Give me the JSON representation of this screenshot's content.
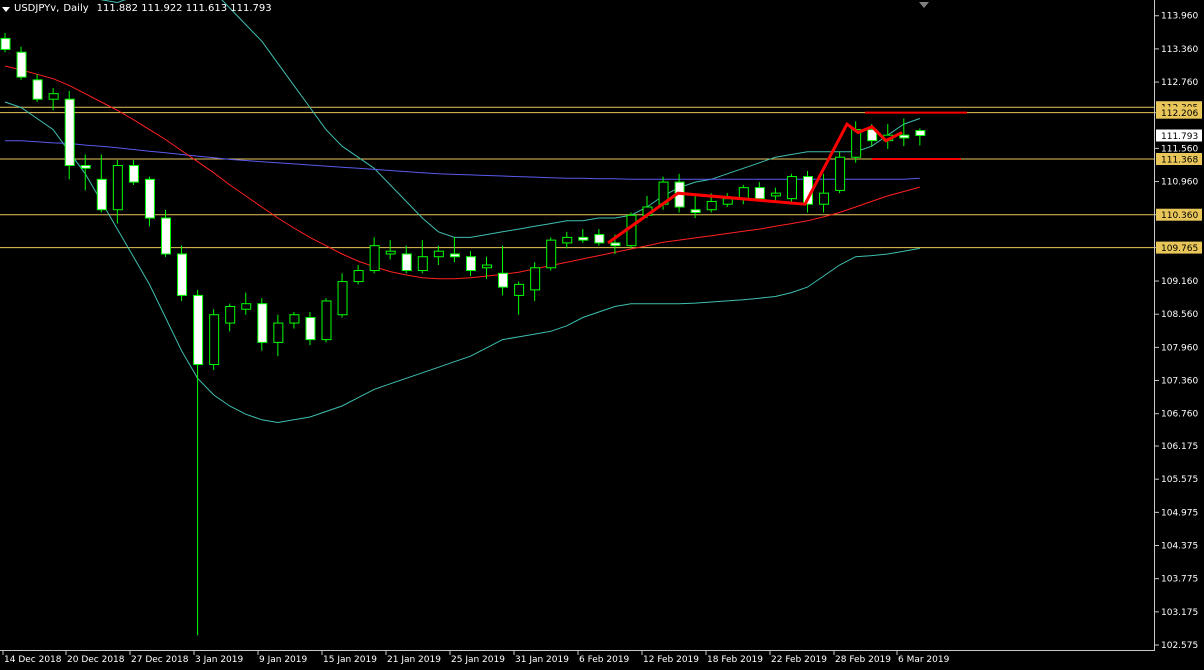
{
  "header": {
    "symbol": "USDJPYv",
    "timeframe": "Daily",
    "ohlc": "111.882 111.922 111.613 111.793"
  },
  "colors": {
    "background": "#000000",
    "bull_candle": "#000000",
    "bear_candle": "#ffffff",
    "wick": "#00ff00",
    "level_line": "#e8c65a",
    "ma_red": "#ff2020",
    "ma_blue": "#5a5af0",
    "band_cyan": "#3fbfb0",
    "drawing_red": "#ff0000"
  },
  "chart_data": {
    "type": "candlestick",
    "symbol": "USDJPYv",
    "timeframe": "Daily",
    "y_range": [
      102.575,
      114.1
    ],
    "y_ticks": [
      "113.960",
      "113.360",
      "112.760",
      "112.206",
      "111.560",
      "110.960",
      "110.360",
      "109.765",
      "109.160",
      "108.560",
      "107.960",
      "107.360",
      "106.760",
      "106.175",
      "105.575",
      "104.975",
      "104.375",
      "103.775",
      "103.175",
      "102.575"
    ],
    "x_labels": [
      "14 Dec 2018",
      "20 Dec 2018",
      "27 Dec 2018",
      "3 Jan 2019",
      "9 Jan 2019",
      "15 Jan 2019",
      "21 Jan 2019",
      "25 Jan 2019",
      "31 Jan 2019",
      "6 Feb 2019",
      "12 Feb 2019",
      "18 Feb 2019",
      "22 Feb 2019",
      "28 Feb 2019",
      "6 Mar 2019"
    ],
    "current_price": "111.793",
    "horizontal_levels": [
      {
        "price": 112.305,
        "label": "112.305"
      },
      {
        "price": 112.206,
        "label": "112.206"
      },
      {
        "price": 111.368,
        "label": "111.368"
      },
      {
        "price": 110.36,
        "label": "110.360"
      },
      {
        "price": 109.765,
        "label": "109.765"
      }
    ],
    "candles": [
      {
        "o": 113.55,
        "h": 113.65,
        "l": 113.3,
        "c": 113.35
      },
      {
        "o": 113.3,
        "h": 113.4,
        "l": 112.8,
        "c": 112.85
      },
      {
        "o": 112.8,
        "h": 112.9,
        "l": 112.4,
        "c": 112.45
      },
      {
        "o": 112.45,
        "h": 112.65,
        "l": 112.25,
        "c": 112.55
      },
      {
        "o": 112.45,
        "h": 112.6,
        "l": 111.0,
        "c": 111.25
      },
      {
        "o": 111.25,
        "h": 111.45,
        "l": 110.8,
        "c": 111.2
      },
      {
        "o": 111.0,
        "h": 111.45,
        "l": 110.4,
        "c": 110.45
      },
      {
        "o": 110.45,
        "h": 111.35,
        "l": 110.2,
        "c": 111.25
      },
      {
        "o": 111.25,
        "h": 111.35,
        "l": 110.9,
        "c": 110.95
      },
      {
        "o": 111.0,
        "h": 111.05,
        "l": 110.15,
        "c": 110.3
      },
      {
        "o": 110.3,
        "h": 110.45,
        "l": 109.6,
        "c": 109.65
      },
      {
        "o": 109.65,
        "h": 109.8,
        "l": 108.8,
        "c": 108.9
      },
      {
        "o": 108.9,
        "h": 109.0,
        "l": 102.75,
        "c": 107.65
      },
      {
        "o": 107.65,
        "h": 108.65,
        "l": 107.55,
        "c": 108.55
      },
      {
        "o": 108.4,
        "h": 108.75,
        "l": 108.25,
        "c": 108.7
      },
      {
        "o": 108.65,
        "h": 108.95,
        "l": 108.55,
        "c": 108.75
      },
      {
        "o": 108.75,
        "h": 108.85,
        "l": 107.9,
        "c": 108.05
      },
      {
        "o": 108.05,
        "h": 108.55,
        "l": 107.8,
        "c": 108.4
      },
      {
        "o": 108.4,
        "h": 108.6,
        "l": 108.3,
        "c": 108.55
      },
      {
        "o": 108.5,
        "h": 108.6,
        "l": 108.0,
        "c": 108.1
      },
      {
        "o": 108.1,
        "h": 108.85,
        "l": 108.05,
        "c": 108.8
      },
      {
        "o": 108.55,
        "h": 109.3,
        "l": 108.5,
        "c": 109.15
      },
      {
        "o": 109.15,
        "h": 109.45,
        "l": 109.1,
        "c": 109.35
      },
      {
        "o": 109.35,
        "h": 109.95,
        "l": 109.3,
        "c": 109.8
      },
      {
        "o": 109.65,
        "h": 109.9,
        "l": 109.55,
        "c": 109.7
      },
      {
        "o": 109.65,
        "h": 109.8,
        "l": 109.3,
        "c": 109.35
      },
      {
        "o": 109.35,
        "h": 109.9,
        "l": 109.3,
        "c": 109.6
      },
      {
        "o": 109.6,
        "h": 109.8,
        "l": 109.45,
        "c": 109.7
      },
      {
        "o": 109.65,
        "h": 109.95,
        "l": 109.5,
        "c": 109.6
      },
      {
        "o": 109.6,
        "h": 109.7,
        "l": 109.25,
        "c": 109.35
      },
      {
        "o": 109.4,
        "h": 109.6,
        "l": 109.2,
        "c": 109.45
      },
      {
        "o": 109.3,
        "h": 109.8,
        "l": 108.9,
        "c": 109.05
      },
      {
        "o": 108.9,
        "h": 109.15,
        "l": 108.55,
        "c": 109.1
      },
      {
        "o": 109.0,
        "h": 109.5,
        "l": 108.8,
        "c": 109.4
      },
      {
        "o": 109.4,
        "h": 109.95,
        "l": 109.35,
        "c": 109.9
      },
      {
        "o": 109.85,
        "h": 110.05,
        "l": 109.75,
        "c": 109.95
      },
      {
        "o": 109.95,
        "h": 110.1,
        "l": 109.85,
        "c": 109.9
      },
      {
        "o": 110.0,
        "h": 110.1,
        "l": 109.8,
        "c": 109.85
      },
      {
        "o": 109.85,
        "h": 110.0,
        "l": 109.65,
        "c": 109.8
      },
      {
        "o": 109.8,
        "h": 110.4,
        "l": 109.75,
        "c": 110.35
      },
      {
        "o": 110.35,
        "h": 110.7,
        "l": 110.3,
        "c": 110.5
      },
      {
        "o": 110.55,
        "h": 111.05,
        "l": 110.45,
        "c": 110.95
      },
      {
        "o": 110.95,
        "h": 111.1,
        "l": 110.4,
        "c": 110.5
      },
      {
        "o": 110.45,
        "h": 110.7,
        "l": 110.3,
        "c": 110.4
      },
      {
        "o": 110.45,
        "h": 110.75,
        "l": 110.4,
        "c": 110.6
      },
      {
        "o": 110.55,
        "h": 110.75,
        "l": 110.5,
        "c": 110.65
      },
      {
        "o": 110.65,
        "h": 110.9,
        "l": 110.55,
        "c": 110.85
      },
      {
        "o": 110.85,
        "h": 110.95,
        "l": 110.6,
        "c": 110.65
      },
      {
        "o": 110.7,
        "h": 110.85,
        "l": 110.6,
        "c": 110.75
      },
      {
        "o": 110.65,
        "h": 111.1,
        "l": 110.55,
        "c": 111.05
      },
      {
        "o": 111.05,
        "h": 111.15,
        "l": 110.4,
        "c": 110.55
      },
      {
        "o": 110.55,
        "h": 111.1,
        "l": 110.4,
        "c": 110.75
      },
      {
        "o": 110.8,
        "h": 111.5,
        "l": 110.75,
        "c": 111.4
      },
      {
        "o": 111.4,
        "h": 112.05,
        "l": 111.3,
        "c": 111.9
      },
      {
        "o": 111.9,
        "h": 112.0,
        "l": 111.6,
        "c": 111.7
      },
      {
        "o": 111.7,
        "h": 112.0,
        "l": 111.55,
        "c": 111.8
      },
      {
        "o": 111.8,
        "h": 112.1,
        "l": 111.6,
        "c": 111.75
      },
      {
        "o": 111.882,
        "h": 111.922,
        "l": 111.613,
        "c": 111.793
      }
    ],
    "ma_red": [
      113.05,
      112.98,
      112.9,
      112.82,
      112.7,
      112.55,
      112.4,
      112.25,
      112.08,
      111.9,
      111.72,
      111.52,
      111.32,
      111.12,
      110.9,
      110.7,
      110.5,
      110.3,
      110.12,
      109.95,
      109.8,
      109.65,
      109.52,
      109.42,
      109.33,
      109.27,
      109.22,
      109.2,
      109.2,
      109.22,
      109.25,
      109.28,
      109.32,
      109.38,
      109.44,
      109.5,
      109.56,
      109.62,
      109.68,
      109.74,
      109.8,
      109.86,
      109.9,
      109.94,
      109.98,
      110.02,
      110.06,
      110.1,
      110.15,
      110.2,
      110.25,
      110.32,
      110.4,
      110.5,
      110.6,
      110.7,
      110.78,
      110.86
    ],
    "ma_blue": [
      111.7,
      111.7,
      111.68,
      111.66,
      111.65,
      111.62,
      111.6,
      111.57,
      111.54,
      111.51,
      111.48,
      111.45,
      111.42,
      111.39,
      111.36,
      111.34,
      111.32,
      111.3,
      111.28,
      111.26,
      111.24,
      111.22,
      111.2,
      111.18,
      111.16,
      111.14,
      111.12,
      111.1,
      111.09,
      111.08,
      111.07,
      111.06,
      111.05,
      111.04,
      111.03,
      111.02,
      111.02,
      111.01,
      111.01,
      111.0,
      111.0,
      111.0,
      111.0,
      111.0,
      111.0,
      111.0,
      111.0,
      111.0,
      111.0,
      111.0,
      111.0,
      111.0,
      111.0,
      111.0,
      111.0,
      111.0,
      111.0,
      111.02
    ],
    "band_upper": [
      114.6,
      114.5,
      114.45,
      114.4,
      114.35,
      114.3,
      114.25,
      114.2,
      114.3,
      114.4,
      114.5,
      114.6,
      114.6,
      114.4,
      114.1,
      113.8,
      113.5,
      113.1,
      112.7,
      112.3,
      111.9,
      111.6,
      111.4,
      111.2,
      110.9,
      110.6,
      110.3,
      110.05,
      109.95,
      109.95,
      110.0,
      110.05,
      110.1,
      110.15,
      110.2,
      110.25,
      110.25,
      110.3,
      110.3,
      110.35,
      110.5,
      110.7,
      110.85,
      110.95,
      111.0,
      111.1,
      111.2,
      111.3,
      111.4,
      111.45,
      111.5,
      111.5,
      111.5,
      111.5,
      111.6,
      111.8,
      112.0,
      112.1
    ],
    "band_lower": [
      112.4,
      112.3,
      112.1,
      111.9,
      111.5,
      111.1,
      110.6,
      110.1,
      109.6,
      109.1,
      108.5,
      107.9,
      107.4,
      107.1,
      106.9,
      106.75,
      106.65,
      106.6,
      106.65,
      106.7,
      106.8,
      106.9,
      107.05,
      107.2,
      107.3,
      107.4,
      107.5,
      107.6,
      107.7,
      107.8,
      107.95,
      108.1,
      108.15,
      108.2,
      108.25,
      108.35,
      108.5,
      108.6,
      108.7,
      108.75,
      108.75,
      108.75,
      108.75,
      108.76,
      108.78,
      108.8,
      108.82,
      108.85,
      108.88,
      108.95,
      109.05,
      109.25,
      109.45,
      109.6,
      109.62,
      109.65,
      109.7,
      109.75
    ]
  }
}
